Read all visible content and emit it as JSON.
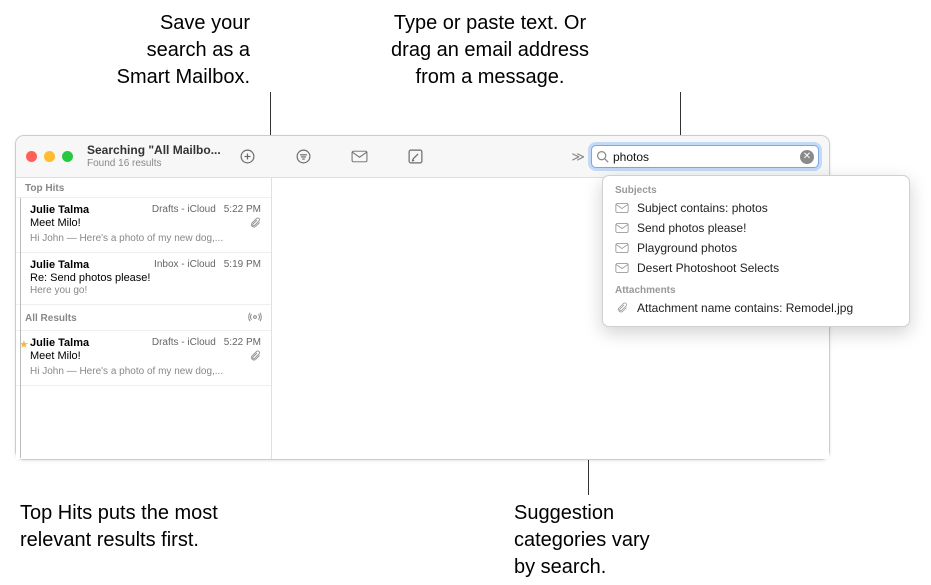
{
  "callouts": {
    "smart_mailbox": "Save your\nsearch as a\nSmart Mailbox.",
    "search_help": "Type or paste text. Or\ndrag an email address\nfrom a message.",
    "top_hits": "Top Hits puts the most\nrelevant results first.",
    "suggestions": "Suggestion\ncategories vary\nby search."
  },
  "window": {
    "title": "Searching \"All Mailbo...",
    "subtitle": "Found 16 results"
  },
  "search": {
    "value": "photos",
    "placeholder": "Search"
  },
  "sections": {
    "top_hits": "Top Hits",
    "all_results": "All Results"
  },
  "messages": [
    {
      "sender": "Julie Talma",
      "mailbox": "Drafts - iCloud",
      "time": "5:22 PM",
      "subject": "Meet Milo!",
      "has_attachment": true,
      "preview": "Hi John — Here's a photo of my new dog,..."
    },
    {
      "sender": "Julie Talma",
      "mailbox": "Inbox - iCloud",
      "time": "5:19 PM",
      "subject": "Re: Send photos please!",
      "has_attachment": false,
      "preview": "Here you go!"
    }
  ],
  "all_results_messages": [
    {
      "starred": true,
      "sender": "Julie Talma",
      "mailbox": "Drafts - iCloud",
      "time": "5:22 PM",
      "subject": "Meet Milo!",
      "has_attachment": true,
      "preview": "Hi John — Here's a photo of my new dog,..."
    }
  ],
  "suggestions": {
    "subjects_header": "Subjects",
    "items_subjects": [
      "Subject contains: photos",
      "Send photos please!",
      "Playground photos",
      "Desert Photoshoot Selects"
    ],
    "attachments_header": "Attachments",
    "items_attachments": [
      "Attachment name contains: Remodel.jpg"
    ]
  }
}
